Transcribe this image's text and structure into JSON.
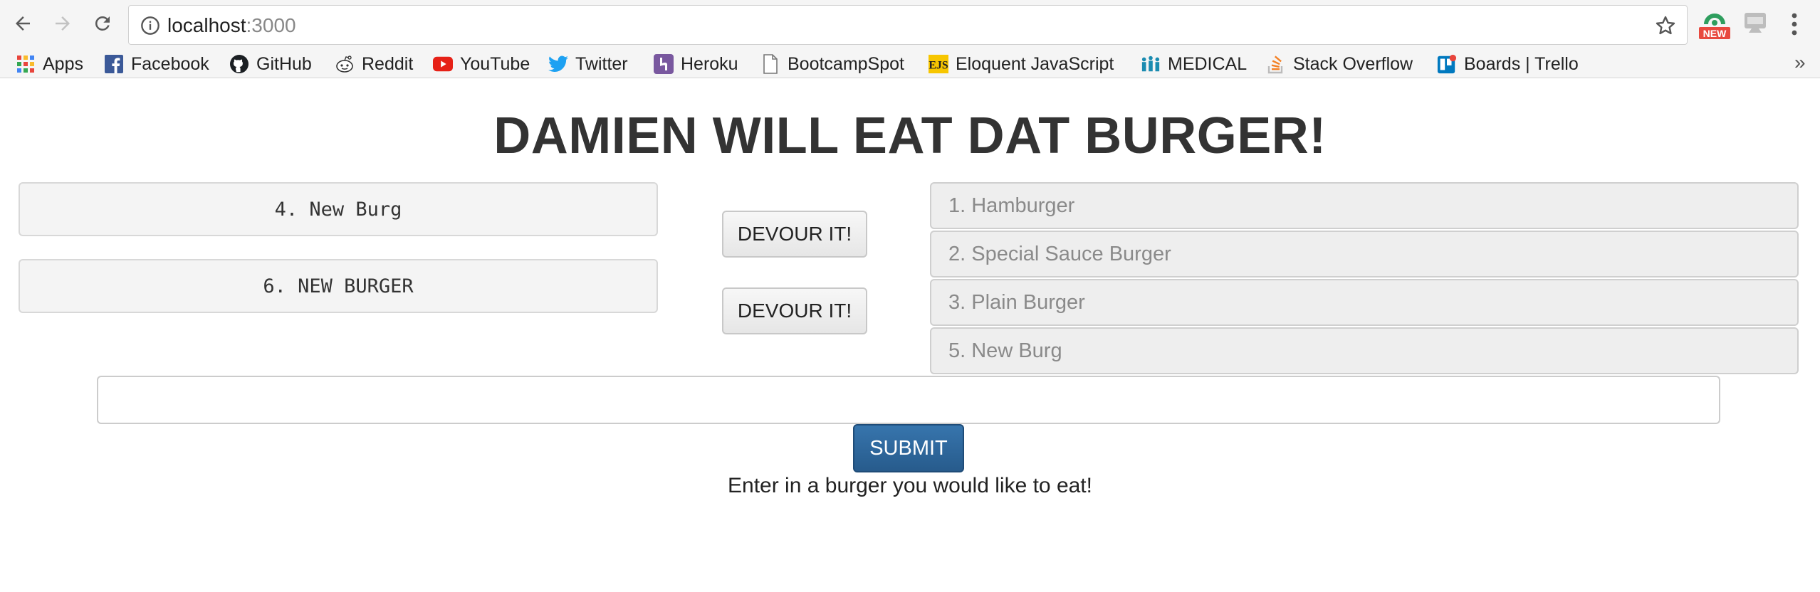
{
  "browser": {
    "url_host": "localhost",
    "url_port": ":3000",
    "ext_new_badge": "NEW",
    "bookmarks": [
      {
        "label": "Apps",
        "icon": "apps-grid-icon"
      },
      {
        "label": "Facebook",
        "icon": "facebook-icon"
      },
      {
        "label": "GitHub",
        "icon": "github-icon"
      },
      {
        "label": "Reddit",
        "icon": "reddit-icon"
      },
      {
        "label": "YouTube",
        "icon": "youtube-icon"
      },
      {
        "label": "Twitter",
        "icon": "twitter-icon"
      },
      {
        "label": "Heroku",
        "icon": "heroku-icon"
      },
      {
        "label": "BootcampSpot",
        "icon": "page-icon"
      },
      {
        "label": "Eloquent JavaScript",
        "icon": "ejs-icon"
      },
      {
        "label": "MEDICAL",
        "icon": "people-icon"
      },
      {
        "label": "Stack Overflow",
        "icon": "stackoverflow-icon"
      },
      {
        "label": "Boards | Trello",
        "icon": "trello-icon"
      }
    ],
    "overflow_chevron": "»"
  },
  "page": {
    "title": "DAMIEN WILL EAT DAT BURGER!",
    "uneaten": [
      {
        "label": "4. New Burg",
        "button": "DEVOUR IT!"
      },
      {
        "label": "6. NEW BURGER",
        "button": "DEVOUR IT!"
      }
    ],
    "devoured": [
      "1. Hamburger",
      "2. Special Sauce Burger",
      "3. Plain Burger",
      "5. New Burg"
    ],
    "form": {
      "input_value": "",
      "input_placeholder": "",
      "submit_label": "SUBMIT",
      "hint": "Enter in a burger you would like to eat!"
    }
  },
  "colors": {
    "submit_bg": "#2d6aa0",
    "title": "#333333",
    "devoured_text": "#8a8a8a"
  }
}
